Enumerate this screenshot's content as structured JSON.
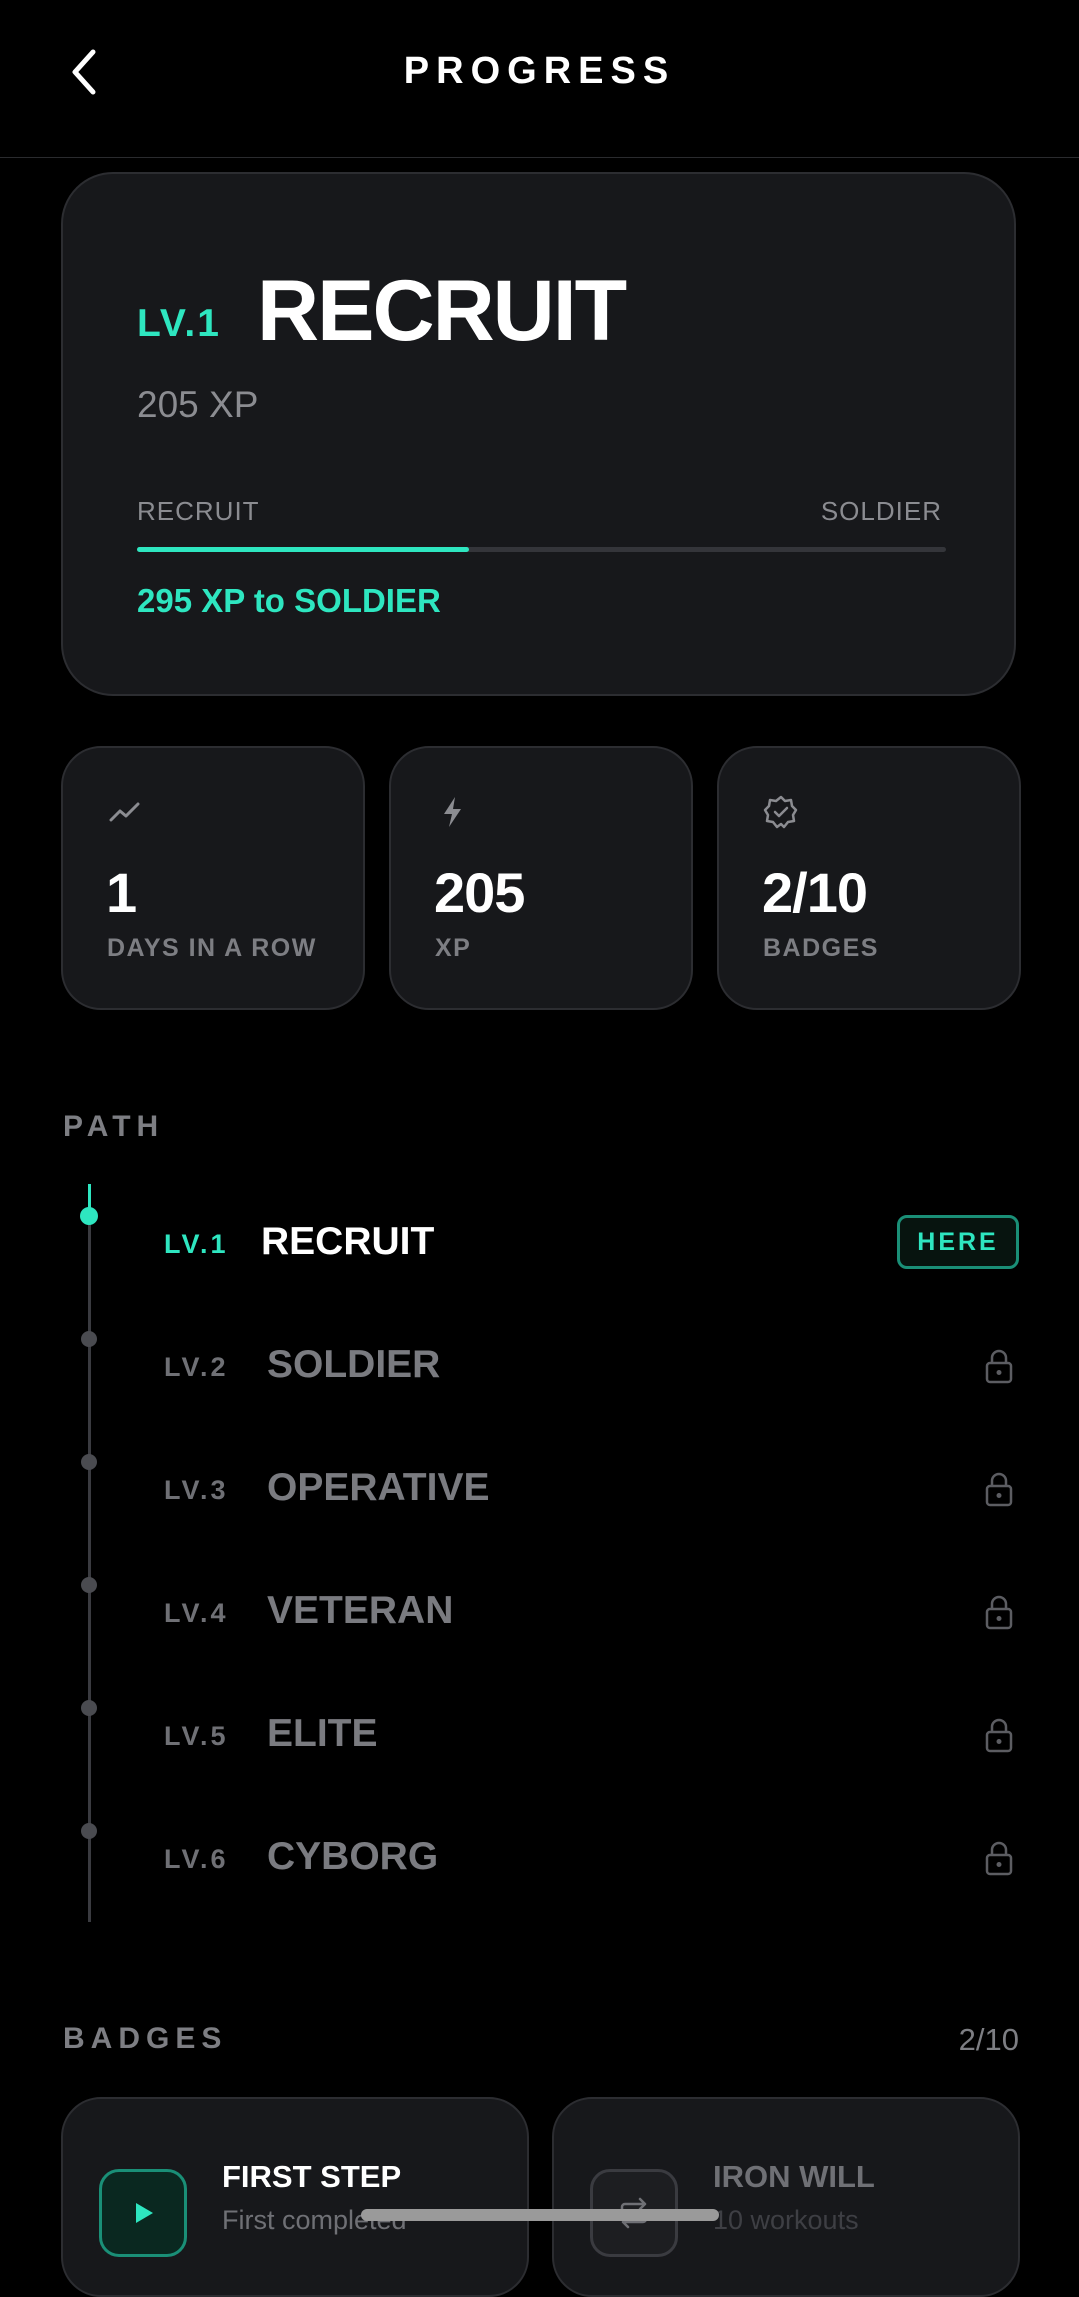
{
  "header": {
    "title": "PROGRESS",
    "back_icon": "chevron-left-icon"
  },
  "level_card": {
    "level_tag": "LV.1",
    "rank": "RECRUIT",
    "xp_current": "205 XP",
    "bar_from": "RECRUIT",
    "bar_to": "SOLDIER",
    "progress_fraction": 0.41,
    "xp_to_next": "295 XP to SOLDIER"
  },
  "stats": [
    {
      "icon": "trend-icon",
      "value": "1",
      "label": "DAYS IN A ROW"
    },
    {
      "icon": "bolt-icon",
      "value": "205",
      "label": "XP"
    },
    {
      "icon": "badge-check-icon",
      "value": "2/10",
      "label": "BADGES"
    }
  ],
  "path": {
    "heading": "PATH",
    "current_badge": "HERE",
    "levels": [
      {
        "lv": "LV.1",
        "name": "RECRUIT",
        "state": "current"
      },
      {
        "lv": "LV.2",
        "name": "SOLDIER",
        "state": "locked"
      },
      {
        "lv": "LV.3",
        "name": "OPERATIVE",
        "state": "locked"
      },
      {
        "lv": "LV.4",
        "name": "VETERAN",
        "state": "locked"
      },
      {
        "lv": "LV.5",
        "name": "ELITE",
        "state": "locked"
      },
      {
        "lv": "LV.6",
        "name": "CYBORG",
        "state": "locked"
      }
    ]
  },
  "badges": {
    "heading": "BADGES",
    "count": "2/10",
    "items": [
      {
        "icon": "play-icon",
        "name": "FIRST STEP",
        "desc": "First completed",
        "state": "earned"
      },
      {
        "icon": "repeat-icon",
        "name": "IRON WILL",
        "desc": "10 workouts",
        "state": "locked"
      }
    ]
  },
  "colors": {
    "accent": "#2ee6c0",
    "card": "#17181b",
    "muted": "#7d7e83",
    "background": "#000000"
  }
}
